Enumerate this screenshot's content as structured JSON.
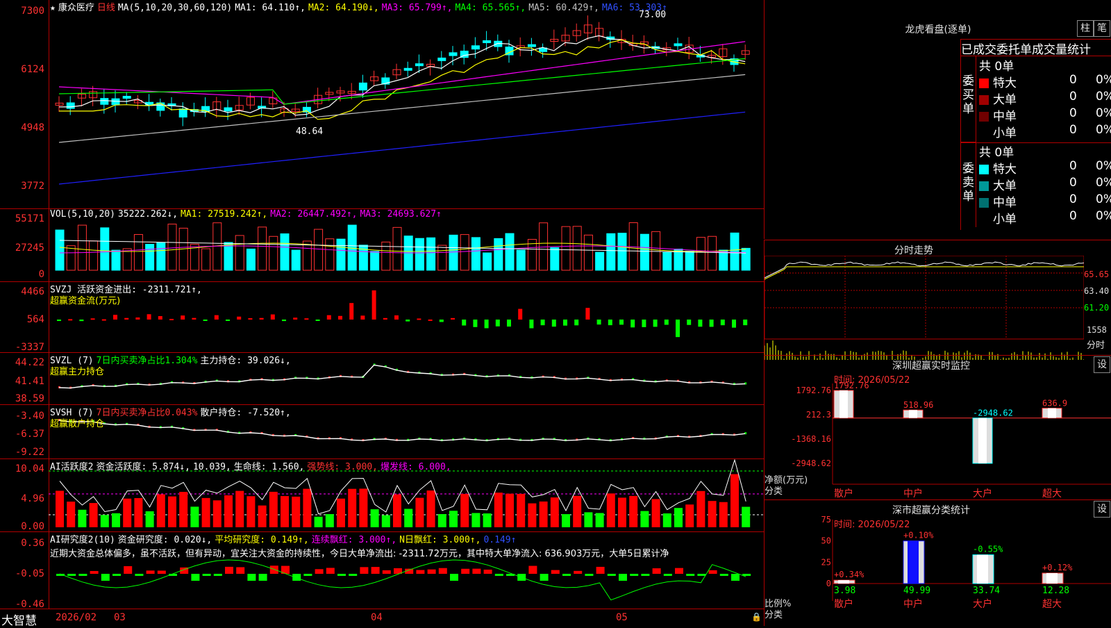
{
  "main": {
    "legend": {
      "star": "★",
      "stock": "康众医疗",
      "period": "日线",
      "ma_params": "MA(5,10,20,30,60,120)",
      "ma1": "MA1: 64.110↑,",
      "ma2": "MA2: 64.190↓,",
      "ma3": "MA3: 65.799↑,",
      "ma4": "MA4: 65.565↑,",
      "ma5": "MA5: 60.429↑,",
      "ma6": "MA6: 53.303↑"
    },
    "ticks": [
      "7300",
      "6124",
      "4948",
      "3772"
    ],
    "label_high": "73.00",
    "label_low": "48.64",
    "colors": {
      "up": "#ff3232",
      "down": "#00ffff",
      "ma1": "#ffffff",
      "ma2": "#ffff00",
      "ma3": "#ff00ff",
      "ma4": "#00ff00",
      "ma5": "#c0c0c0",
      "ma6": "#2020ff"
    }
  },
  "vol": {
    "legend_name": "VOL(5,10,20)",
    "legend_value": "35222.262↓,",
    "ma1": "MA1: 27519.242↑,",
    "ma2": "MA2: 26447.492↑,",
    "ma3": "MA3: 24693.627↑",
    "ticks": [
      "55171",
      "27245",
      "0"
    ]
  },
  "svzj": {
    "legend": "SVZJ  活跃资金进出: -2311.721↑,",
    "sub": "超赢资金流(万元)",
    "ticks": [
      "4466",
      "564",
      "-3337"
    ]
  },
  "svzl": {
    "name": "SVZL (7)",
    "ratio": "7日内买卖净占比1.304%",
    "hold": "主力持仓: 39.026↓,",
    "sub": "超赢主力持仓",
    "ticks": [
      "44.22",
      "41.41",
      "38.59"
    ]
  },
  "svsh": {
    "name": "SVSH (7)",
    "ratio": "7日内买卖净占比0.043%",
    "hold": "散户持仓: -7.520↑,",
    "sub": "超赢散户持仓",
    "ticks": [
      "-3.40",
      "-6.37",
      "-9.22"
    ]
  },
  "ai1": {
    "name": "AI活跃度2",
    "a": "资金活跃度: 5.874↓,",
    "b": "10.039,",
    "c": "生命线: 1.560,",
    "d": "强势线: 3.000,",
    "e": "爆发线: 6.000,",
    "ticks": [
      "10.04",
      "4.96",
      "0.00"
    ]
  },
  "ai2": {
    "name": "AI研究度2(10)",
    "a": "资金研究度: 0.020↓,",
    "b": "平均研究度: 0.149↑,",
    "c": "连续飘红: 3.000↑,",
    "d": "N日飘红: 3.000↑,",
    "e": "0.149↑",
    "comment": "近期大资金总体偏多，虽不活跃，但有异动，宜关注大资金的持续性，今日大单净流出: -2311.72万元，其中特大单净流入: 636.903万元，大单5日累计净",
    "ticks": [
      "0.36",
      "-0.05",
      "-0.46"
    ]
  },
  "footer": {
    "brand": "大智慧",
    "date": "2026/02",
    "m1": "03",
    "m2": "04",
    "m3": "05"
  },
  "dragon": {
    "title": "龙虎看盘(逐单)",
    "btn1": "柱",
    "btn2": "笔",
    "tabs": "已成交委托单成交量统计",
    "buy_label": "委买单",
    "sell_label": "委卖单",
    "buy_total": "共 0单",
    "sell_total": "共 0单",
    "buy_rows": [
      {
        "name": "特大",
        "num": "0",
        "pct": "0%",
        "color": "#ff0000"
      },
      {
        "name": "大单",
        "num": "0",
        "pct": "0%",
        "color": "#a00000"
      },
      {
        "name": "中单",
        "num": "0",
        "pct": "0%",
        "color": "#700000"
      },
      {
        "name": "小单",
        "num": "0",
        "pct": "0%",
        "color": "#000000"
      }
    ],
    "sell_rows": [
      {
        "name": "特大",
        "num": "0",
        "pct": "0%",
        "color": "#00ffff"
      },
      {
        "name": "大单",
        "num": "0",
        "pct": "0%",
        "color": "#009898"
      },
      {
        "name": "中单",
        "num": "0",
        "pct": "0%",
        "color": "#007070"
      },
      {
        "name": "小单",
        "num": "0",
        "pct": "0%",
        "color": "#000000"
      }
    ]
  },
  "intraday": {
    "title": "分时走势",
    "ticks": [
      "65.65",
      "63.40",
      "61.20"
    ],
    "vol_tick": "1558",
    "vol_label": "分时"
  },
  "monitor": {
    "title": "深圳超赢实时监控",
    "btn": "设",
    "time": "时间: 2026/05/22",
    "ticks": [
      "1792.76",
      "212.3",
      "-1368.16",
      "-2948.62"
    ],
    "ylabel1": "净额(万元)",
    "ylabel2": "分类",
    "categories": [
      "散户",
      "中户",
      "大户",
      "超大"
    ],
    "values": [
      1792.76,
      518.96,
      -2948.62,
      636.9
    ],
    "value_labels": [
      "1792.76",
      "518.96",
      "-2948.62",
      "636.9"
    ]
  },
  "classify": {
    "title": "深市超赢分类统计",
    "btn": "设",
    "time": "时间: 2026/05/22",
    "ticks": [
      "75",
      "50",
      "25",
      "0"
    ],
    "ylabel1": "比例%",
    "ylabel2": "分类",
    "categories": [
      "散户",
      "中户",
      "大户",
      "超大"
    ],
    "values": [
      3.98,
      49.99,
      33.74,
      12.28
    ],
    "value_labels": [
      "3.98",
      "49.99",
      "33.74",
      "12.28"
    ],
    "change_labels": [
      "+0.34%",
      "+0.10%",
      "-0.55%",
      "+0.12%"
    ]
  }
}
